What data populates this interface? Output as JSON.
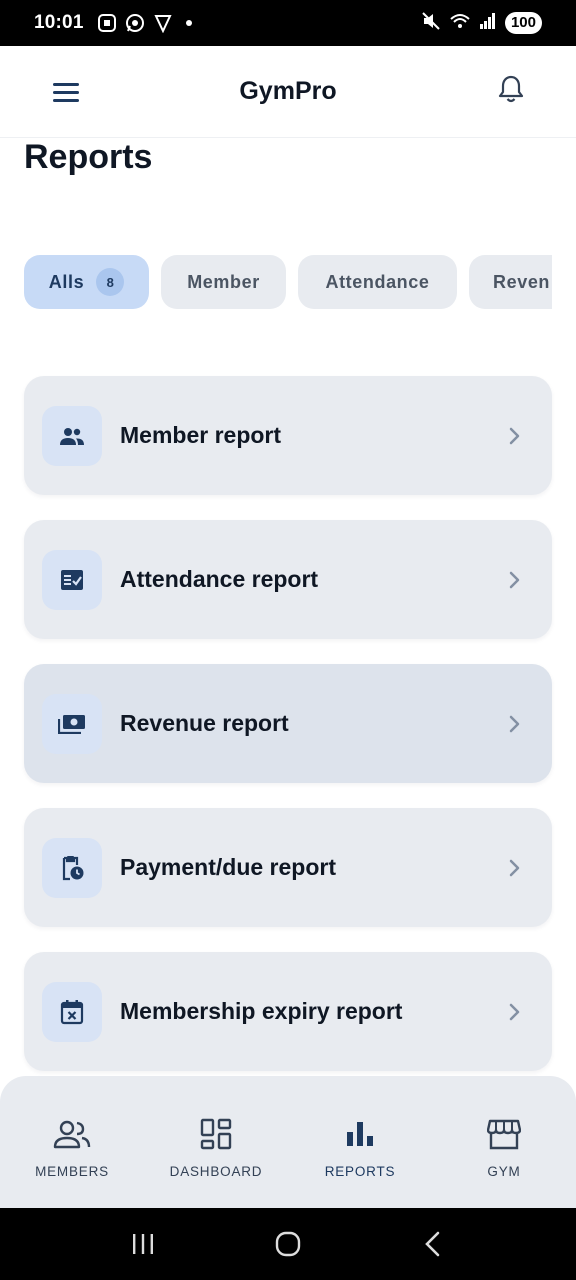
{
  "status_bar": {
    "time": "10:01",
    "battery": "100",
    "icons": [
      "screenshot-icon",
      "whatsapp-icon",
      "vpn-icon",
      "mute-icon",
      "wifi-icon",
      "signal-icon"
    ]
  },
  "header": {
    "title": "GymPro"
  },
  "page": {
    "title": "Reports"
  },
  "filters": {
    "chips": [
      {
        "label": "Alls",
        "count": "8",
        "active": true
      },
      {
        "label": "Member"
      },
      {
        "label": "Attendance"
      },
      {
        "label": "Reven"
      }
    ]
  },
  "reports": [
    {
      "label": "Member report",
      "icon": "members-icon"
    },
    {
      "label": "Attendance report",
      "icon": "attendance-check-icon"
    },
    {
      "label": "Revenue report",
      "icon": "money-icon"
    },
    {
      "label": "Payment/due report",
      "icon": "clipboard-clock-icon"
    },
    {
      "label": "Membership expiry report",
      "icon": "calendar-x-icon"
    }
  ],
  "bottom_nav": [
    {
      "label": "MEMBERS",
      "icon": "members-icon"
    },
    {
      "label": "DASHBOARD",
      "icon": "dashboard-icon"
    },
    {
      "label": "REPORTS",
      "icon": "bar-chart-icon",
      "active": true
    },
    {
      "label": "GYM",
      "icon": "storefront-icon"
    }
  ],
  "colors": {
    "accent": "#1e3a60",
    "chip_active_bg": "#c7daf6",
    "card_bg": "#e8ebf0",
    "icon_tile_bg": "#d8e3f5"
  }
}
